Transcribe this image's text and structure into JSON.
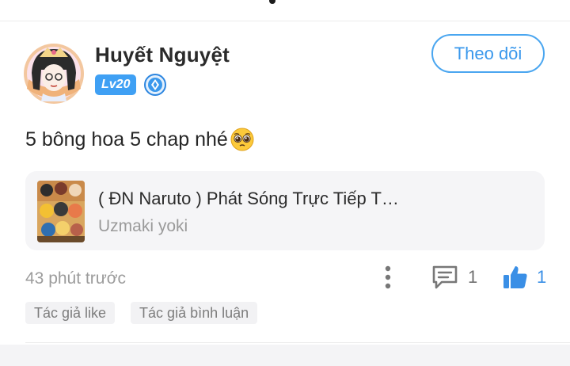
{
  "post": {
    "author": {
      "name": "Huyết Nguyệt",
      "level": "Lv20",
      "avatar_icon": "anime-girl-avatar",
      "badge_icon": "blue-gem-icon"
    },
    "follow_label": "Theo dõi",
    "comment_text": "5 bông hoa 5 chap nhé",
    "comment_emoji": "pleading-face-emoji",
    "book": {
      "title": "( ĐN Naruto ) Phát Sóng Trực Tiếp T…",
      "author": "Uzmaki yoki",
      "cover_icon": "naruto-group-cover"
    },
    "timestamp": "43 phút trước",
    "comment_count": "1",
    "like_count": "1",
    "tags": [
      "Tác giả like",
      "Tác giả bình luận"
    ]
  },
  "colors": {
    "accent": "#3a98ec",
    "level_badge": "#3fa0f4",
    "like": "#3a8fe6"
  }
}
